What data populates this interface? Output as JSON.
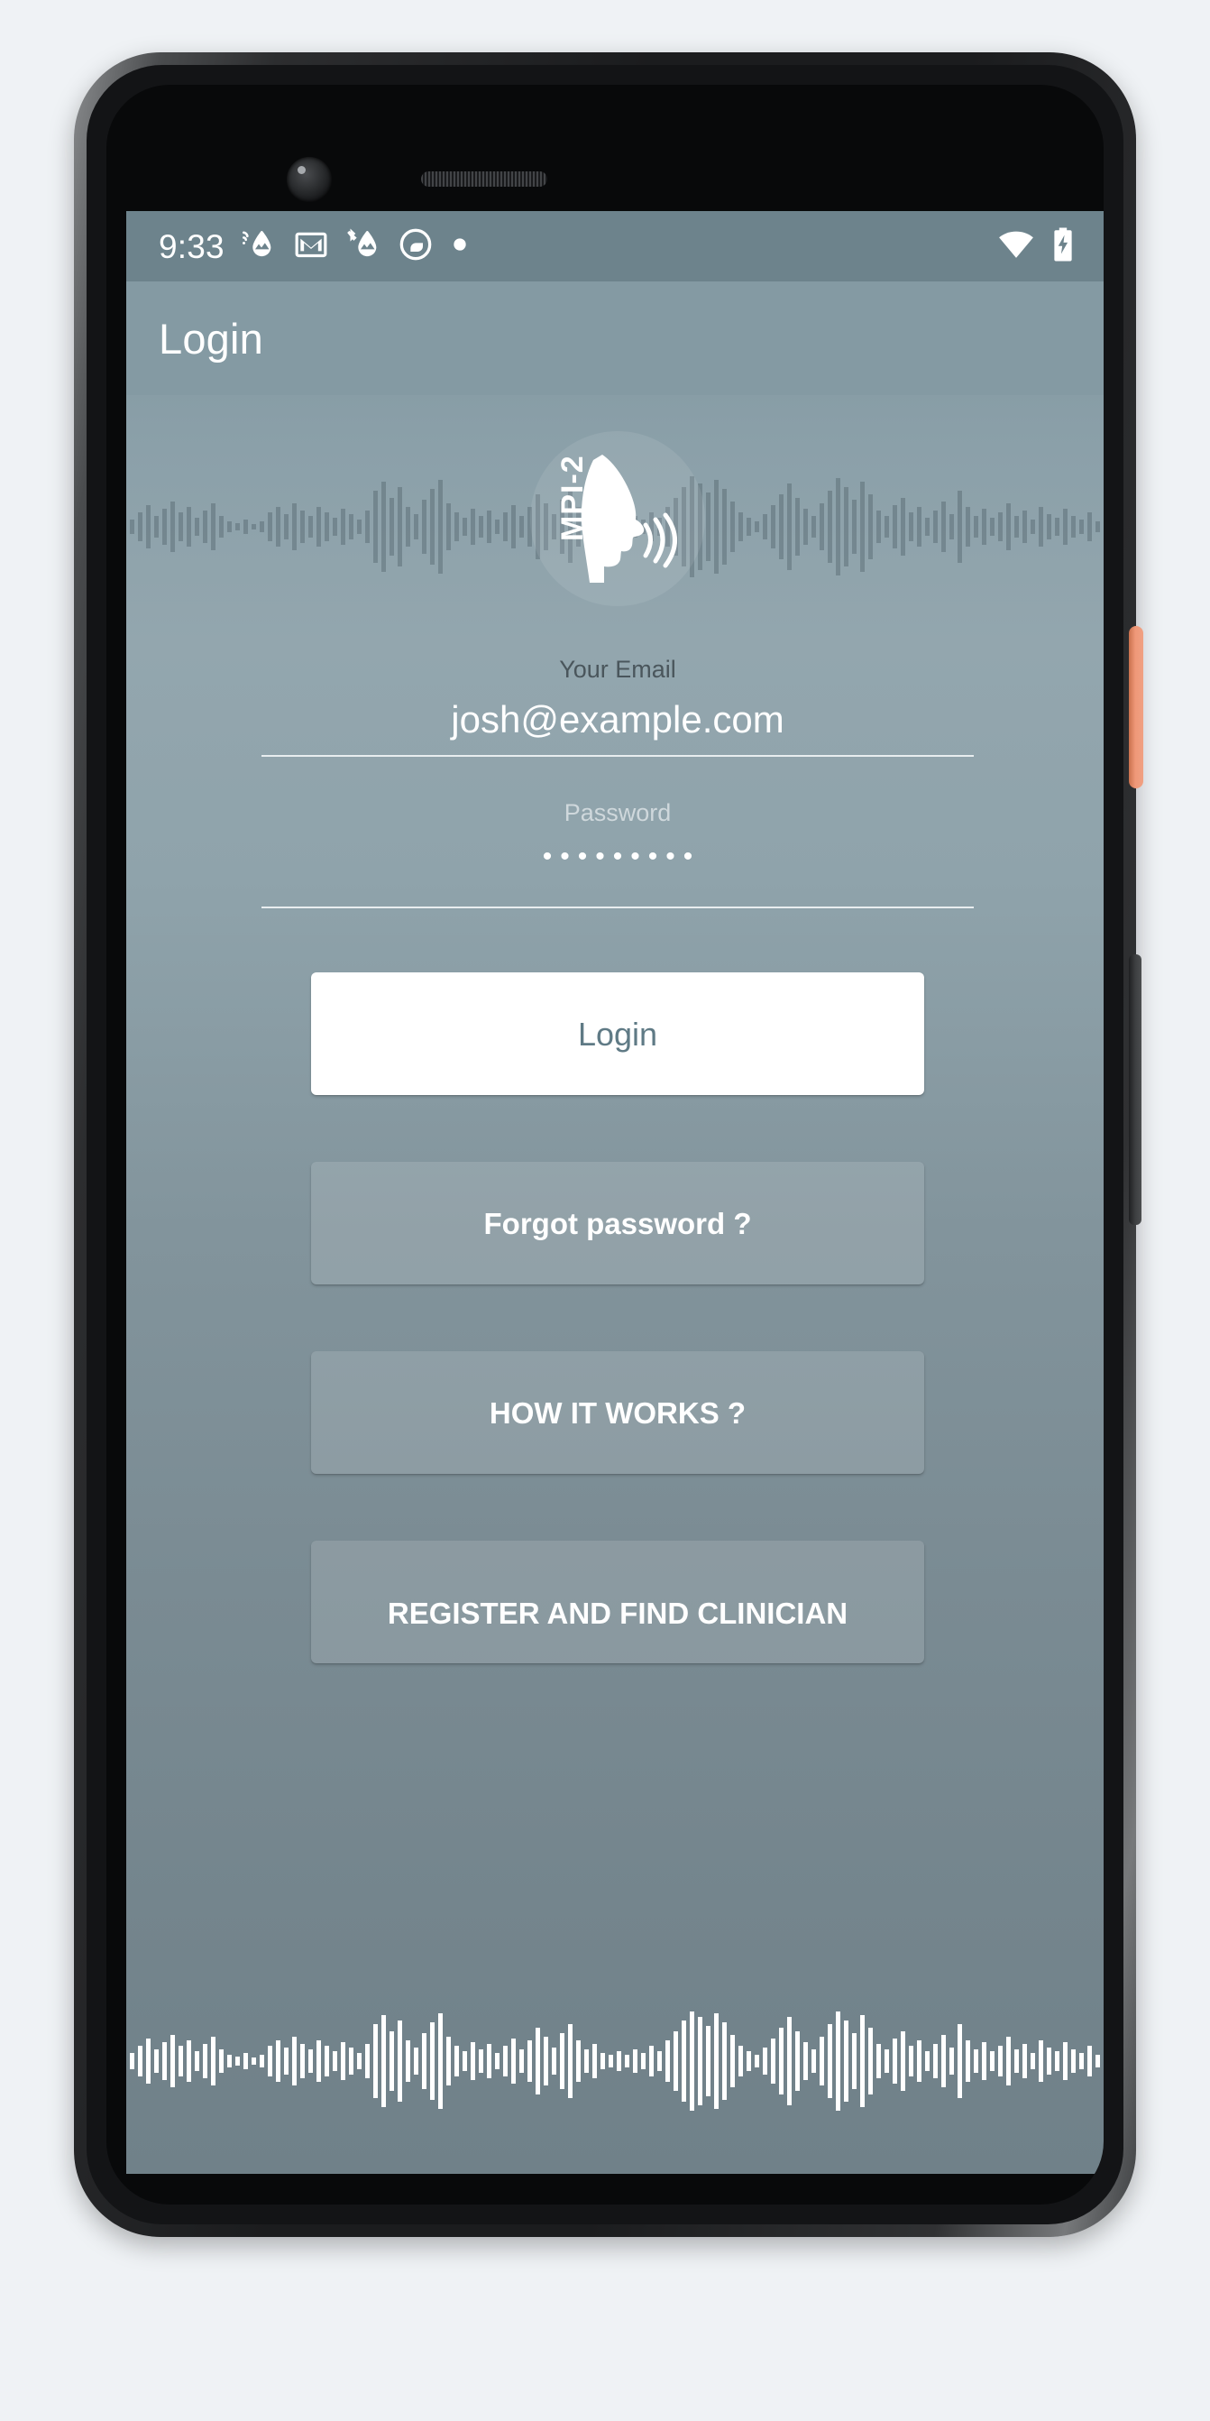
{
  "device": {
    "name": "android-phone-mockup",
    "frame_color": "#1b1c1e",
    "power_button_color": "#ef9878"
  },
  "status_bar": {
    "time": "9:33",
    "notification_icons": [
      "cast-water-drop-icon",
      "gmail-icon",
      "bluetooth-water-drop-icon",
      "do-not-disturb-icon",
      "dot-icon"
    ],
    "system_icons": [
      "wifi-icon",
      "battery-charging-icon"
    ],
    "background": "#6d838c"
  },
  "app_bar": {
    "title": "Login",
    "background": "#849aa3"
  },
  "branding": {
    "logo_text": "MPI-2",
    "logo_alt": "mpi-2-face-soundwave-logo"
  },
  "form": {
    "email": {
      "label": "Your Email",
      "value": "josh@example.com",
      "placeholder": "Your Email"
    },
    "password": {
      "label": "Password",
      "value": "•••••••••",
      "placeholder": "Password",
      "char_count": 9
    }
  },
  "actions": {
    "login": "Login",
    "forgot_password": "Forgot password ?",
    "how_it_works": "HOW IT WORKS ?",
    "register": "REGISTER AND FIND CLINICIAN"
  },
  "theme": {
    "screen_top": "#7d939c",
    "screen_bottom": "#708189",
    "primary_button_bg": "#ffffff",
    "primary_button_text": "#5f7a85",
    "secondary_button_text": "#ffffff",
    "underline": "#e8edef",
    "page_background": "#eff2f5"
  },
  "decoration": {
    "top_waveform": "audio-waveform-muted",
    "bottom_waveform": "audio-waveform-white"
  }
}
